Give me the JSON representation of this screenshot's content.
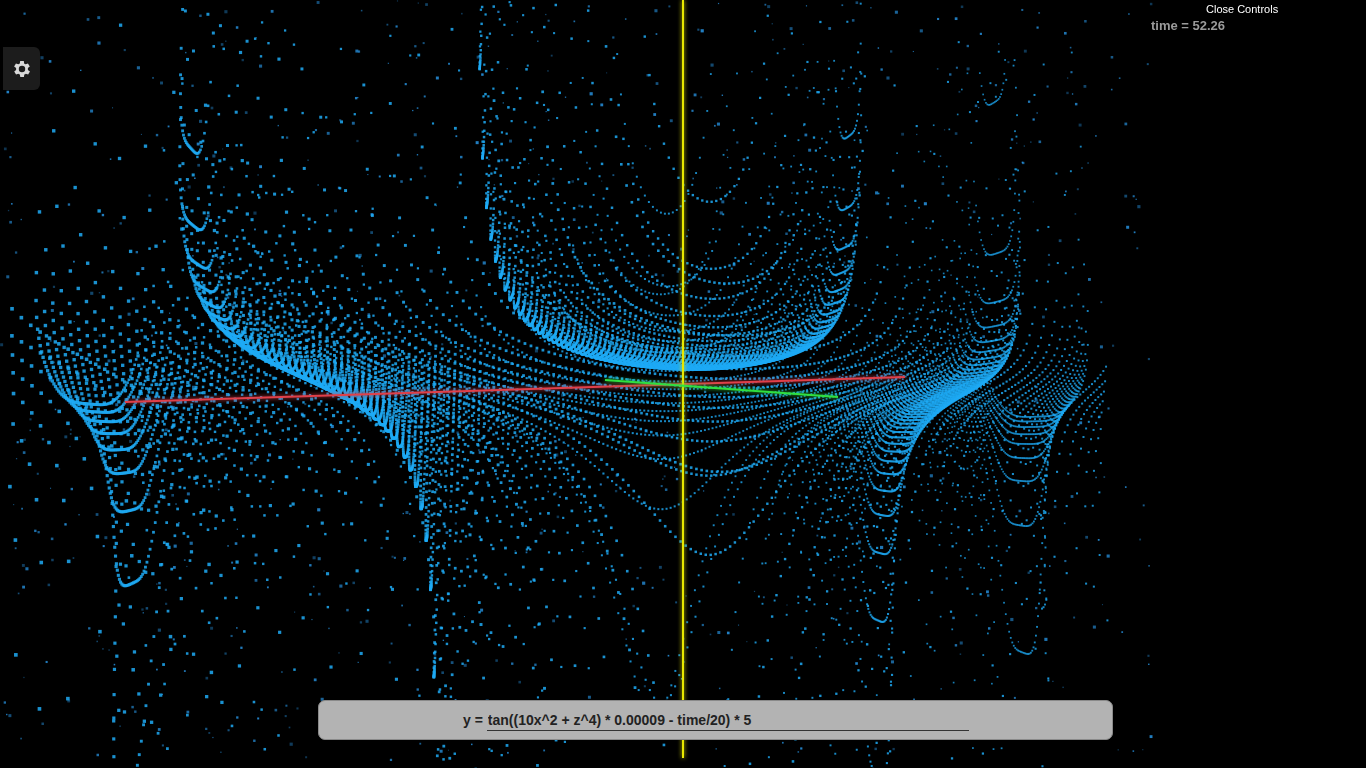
{
  "controls": {
    "toggle_label": "Close Controls"
  },
  "time_readout": "time = 52.26",
  "equation": {
    "label": "y =",
    "value": "tan((10x^2 + z^4) * 0.00009 - time/20) * 5"
  },
  "axes": [
    {
      "kind": "x",
      "color": "#e0404a"
    },
    {
      "kind": "y",
      "color": "#e8e800"
    },
    {
      "kind": "z",
      "color": "#30e040"
    }
  ]
}
